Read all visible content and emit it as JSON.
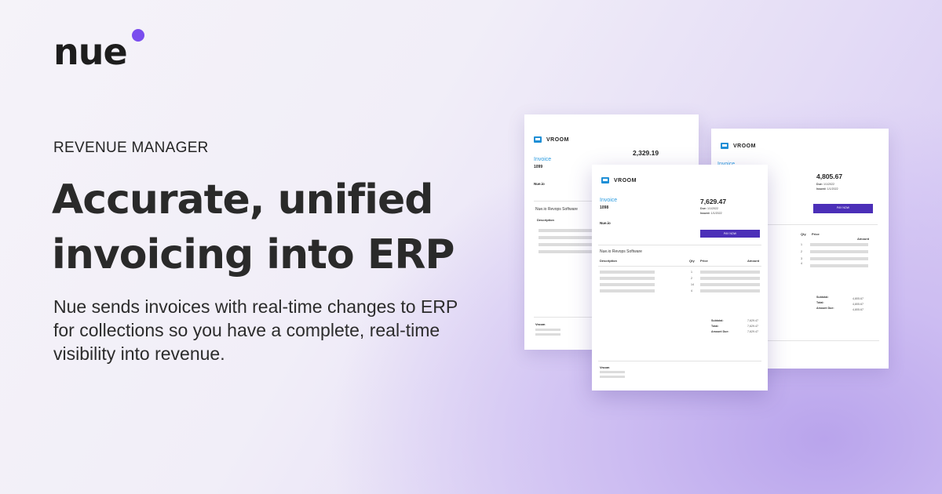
{
  "logo": {
    "text": "nue",
    "dot_color": "#7a4dee"
  },
  "eyebrow": "REVENUE MANAGER",
  "headline": "Accurate, unified invoicing into ERP",
  "subtext": "Nue sends invoices with real-time changes to ERP for collections so you have a complete, real-time visibility into revenue.",
  "invoices": {
    "left": {
      "brand": "VROOM",
      "label": "Invoice",
      "number": "1099",
      "amount": "2,329.19",
      "from": "Nue.io",
      "product": "Nue.io Revops Software",
      "col_description": "Description",
      "footer": "Vroom"
    },
    "right": {
      "brand": "VROOM",
      "label": "Invoice",
      "amount": "4,805.67",
      "due_label": "Due:",
      "due_value": "1/1/2022",
      "issued_label": "Issued:",
      "issued_value": "1/1/2022",
      "pay_label": "PAY NOW",
      "col_qty": "Qty",
      "col_price": "Price",
      "col_amount": "Amount",
      "qtys": [
        "1",
        "2",
        "3",
        "4"
      ],
      "subtotal_label": "Subtotal:",
      "total_label": "Total:",
      "amount_due_label": "Amount Due:",
      "subtotal_value": "4,805.67",
      "total_value": "4,805.67",
      "amount_due_value": "4,805.67"
    },
    "front": {
      "brand": "VROOM",
      "label": "Invoice",
      "number": "1098",
      "amount": "7,629.47",
      "due_label": "Due:",
      "due_value": "1/1/2022",
      "issued_label": "Issued:",
      "issued_value": "1/1/2022",
      "from": "Nue.io",
      "pay_label": "PAY NOW",
      "product": "Nue.io Revops Software",
      "col_description": "Description",
      "col_qty": "Qty",
      "col_price": "Price",
      "col_amount": "Amount",
      "qtys": [
        "1",
        "2",
        "14",
        "4"
      ],
      "subtotal_label": "Subtotal:",
      "total_label": "Total:",
      "amount_due_label": "Amount Due:",
      "subtotal_value": "7,629.47",
      "total_value": "7,629.47",
      "amount_due_value": "7,629.47",
      "footer": "Vroom"
    }
  }
}
